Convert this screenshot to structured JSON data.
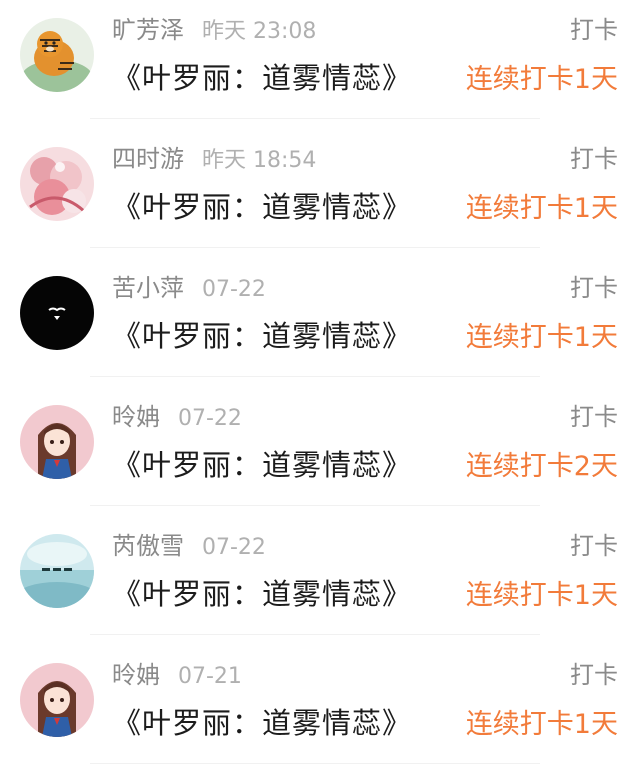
{
  "feed": {
    "items": [
      {
        "name": "旷芳泽",
        "time": "昨天 23:08",
        "action": "打卡",
        "book": "《叶罗丽：道雾情蕊》",
        "streak": "连续打卡1天",
        "avatar_icon": "tiger-avatar-icon"
      },
      {
        "name": "四时游",
        "time": "昨天 18:54",
        "action": "打卡",
        "book": "《叶罗丽：道雾情蕊》",
        "streak": "连续打卡1天",
        "avatar_icon": "pink-illustration-avatar-icon"
      },
      {
        "name": "苦小萍",
        "time": "07-22",
        "action": "打卡",
        "book": "《叶罗丽：道雾情蕊》",
        "streak": "连续打卡1天",
        "avatar_icon": "black-avatar-icon"
      },
      {
        "name": "昤姌",
        "time": "07-22",
        "action": "打卡",
        "book": "《叶罗丽：道雾情蕊》",
        "streak": "连续打卡2天",
        "avatar_icon": "anime-girl-avatar-icon"
      },
      {
        "name": "芮傲雪",
        "time": "07-22",
        "action": "打卡",
        "book": "《叶罗丽：道雾情蕊》",
        "streak": "连续打卡1天",
        "avatar_icon": "sky-landscape-avatar-icon"
      },
      {
        "name": "昤姌",
        "time": "07-21",
        "action": "打卡",
        "book": "《叶罗丽：道雾情蕊》",
        "streak": "连续打卡1天",
        "avatar_icon": "anime-girl-avatar-icon"
      }
    ]
  },
  "colors": {
    "streak": "#f27b3a",
    "name": "#8a8a8a",
    "time": "#b0b0b0",
    "book": "#1c1c1c"
  }
}
